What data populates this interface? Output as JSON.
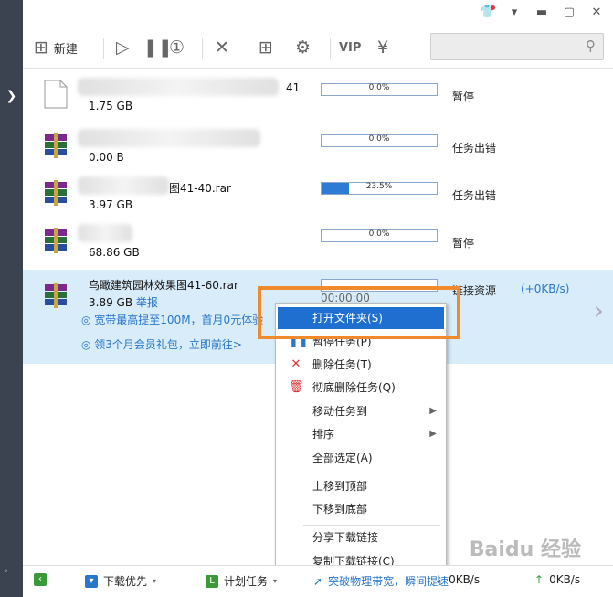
{
  "toolbar": {
    "new_label": "新建",
    "vip_label": "VIP"
  },
  "tasks": [
    {
      "name_tail": "41",
      "size": "1.75 GB",
      "progress": 0.0,
      "progress_label": "0.0%",
      "status": "暂停"
    },
    {
      "name_tail": "",
      "size": "0.00 B",
      "progress": 0.0,
      "progress_label": "0.0%",
      "status": "任务出错"
    },
    {
      "name_tail": "图41-40.rar",
      "size": "3.97 GB",
      "progress": 23.5,
      "progress_label": "23.5%",
      "status": "任务出错"
    },
    {
      "name_tail": "",
      "size": "68.86 GB",
      "progress": 0.0,
      "progress_label": "0.0%",
      "status": "暂停"
    }
  ],
  "selected_task": {
    "name": "鸟瞰建筑园林效果图41-60.rar",
    "size": "3.89 GB",
    "report_link": "举报",
    "time": "00:00:00",
    "status": "链接资源",
    "speed": "(+0KB/s)",
    "promo1": "宽带最高提至100M，首月0元体验",
    "promo2": "领3个月会员礼包，立即前往>"
  },
  "context_menu": {
    "open_folder": "打开文件夹(S)",
    "pause": "暂停任务(P)",
    "delete": "删除任务(T)",
    "delete_all": "彻底删除任务(Q)",
    "move_to": "移动任务到",
    "sort": "排序",
    "select_all": "全部选定(A)",
    "move_top": "上移到顶部",
    "move_bottom": "下移到底部",
    "share_link": "分享下载链接",
    "copy_link": "复制下载链接(C)"
  },
  "statusbar": {
    "priority": "下载优先",
    "scheduled": "计划任务",
    "speedup": "突破物理带宽，瞬间提速",
    "down_speed": "0KB/s",
    "up_speed": "0KB/s"
  },
  "watermark": "Baidu 经验",
  "colors": {
    "accent": "#1f6fd0",
    "highlight_border": "#f08a2d",
    "selected_row": "#d8ecf9"
  }
}
